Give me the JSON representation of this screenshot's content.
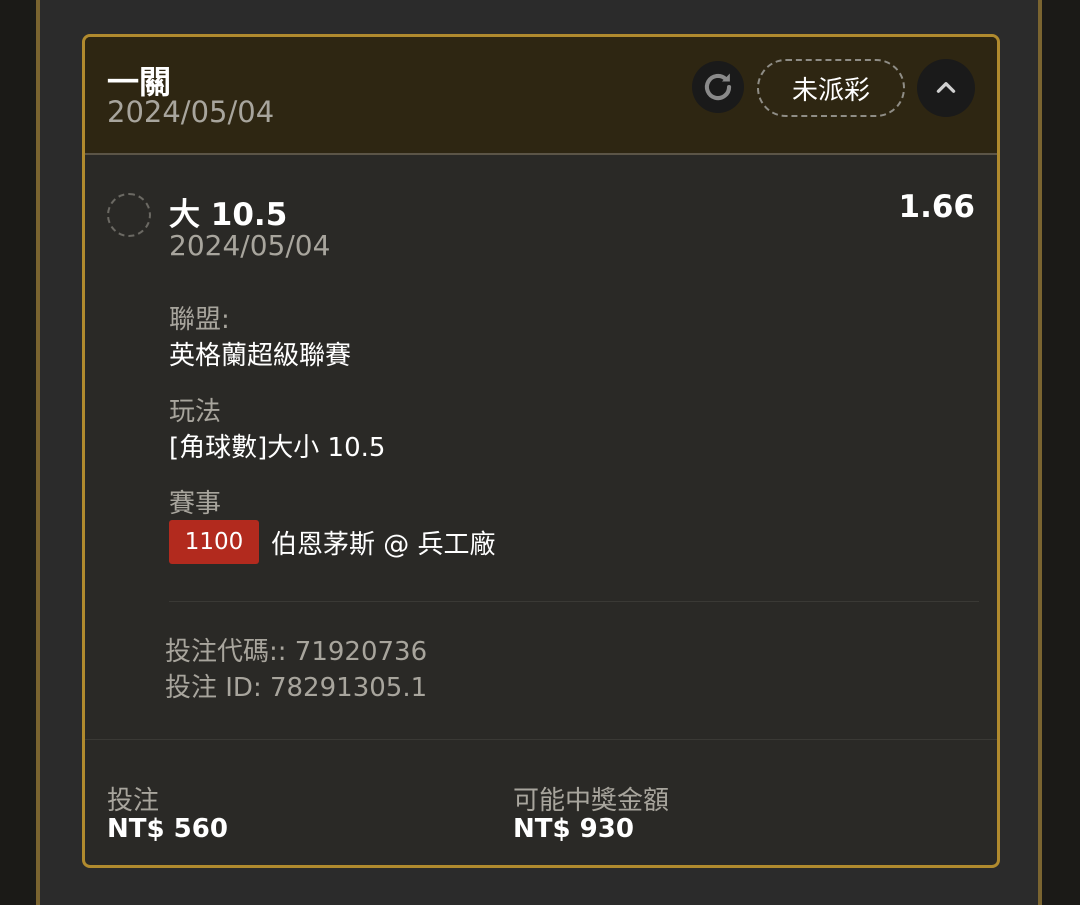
{
  "header": {
    "title": "一關",
    "date": "2024/05/04",
    "status": "未派彩",
    "refresh_icon": "refresh-icon",
    "collapse_icon": "chevron-up-icon"
  },
  "bet": {
    "selection": "大 10.5",
    "odds": "1.66",
    "date": "2024/05/04",
    "league_label": "聯盟:",
    "league_value": "英格蘭超級聯賽",
    "market_label": "玩法",
    "market_value": "[角球數]大小 10.5",
    "event_label": "賽事",
    "event_code": "1100",
    "event_teams": "伯恩茅斯 @ 兵工廠",
    "bet_code": "投注代碼:: 71920736",
    "bet_id": "投注 ID: 78291305.1"
  },
  "footer": {
    "stake_label": "投注",
    "stake_value": "NT$ 560",
    "payout_label": "可能中獎金額",
    "payout_value": "NT$ 930"
  },
  "colors": {
    "accent_border": "#b08a2e",
    "header_bg": "#2e2612",
    "event_badge": "#b22a1e"
  }
}
